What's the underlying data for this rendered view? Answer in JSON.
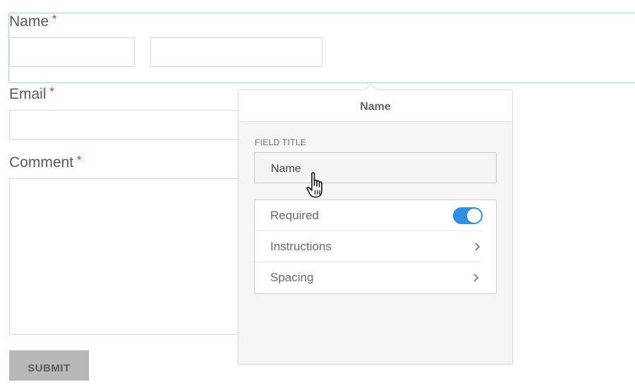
{
  "form": {
    "name_label": "Name",
    "email_label": "Email",
    "comment_label": "Comment",
    "required_marker": "*",
    "submit_label": "SUBMIT"
  },
  "popover": {
    "title": "Name",
    "field_title_label": "FIELD TITLE",
    "field_title_value": "Name",
    "options": {
      "required_label": "Required",
      "required_on": true,
      "instructions_label": "Instructions",
      "spacing_label": "Spacing"
    }
  },
  "colors": {
    "accent": "#2f8ee7",
    "required": "#e2242a",
    "selection_outline": "#9fd0ee"
  },
  "icons": [
    "chevron-right-icon",
    "hand-pointer-icon"
  ]
}
